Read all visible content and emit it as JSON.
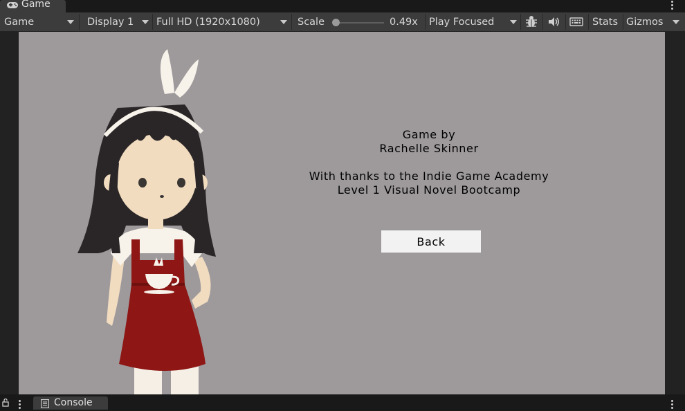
{
  "tabs": {
    "game_label": "Game",
    "console_label": "Console"
  },
  "toolbar": {
    "view_select": "Game",
    "display_select": "Display 1",
    "resolution_select": "Full HD (1920x1080)",
    "scale_label": "Scale",
    "scale_value": "0.49x",
    "scale_fraction": 0.03,
    "play_mode_select": "Play Focused",
    "stats_label": "Stats",
    "gizmos_label": "Gizmos"
  },
  "game": {
    "credits": [
      "Game by",
      "Rachelle Skinner",
      "",
      "With thanks to the Indie Game Academy",
      "Level 1 Visual Novel Bootcamp"
    ],
    "back_button": "Back"
  },
  "colors": {
    "editor_bg": "#191919",
    "toolbar_bg": "#3c3c3c",
    "game_bg": "#9e9a9c",
    "apron_red": "#8e1614",
    "hair_black": "#2a2627"
  },
  "icons": [
    "gamepad-icon",
    "kebab-menu-icon",
    "chevron-down-icon",
    "bug-icon",
    "audio-icon",
    "keyboard-icon",
    "lock-icon",
    "console-icon"
  ]
}
